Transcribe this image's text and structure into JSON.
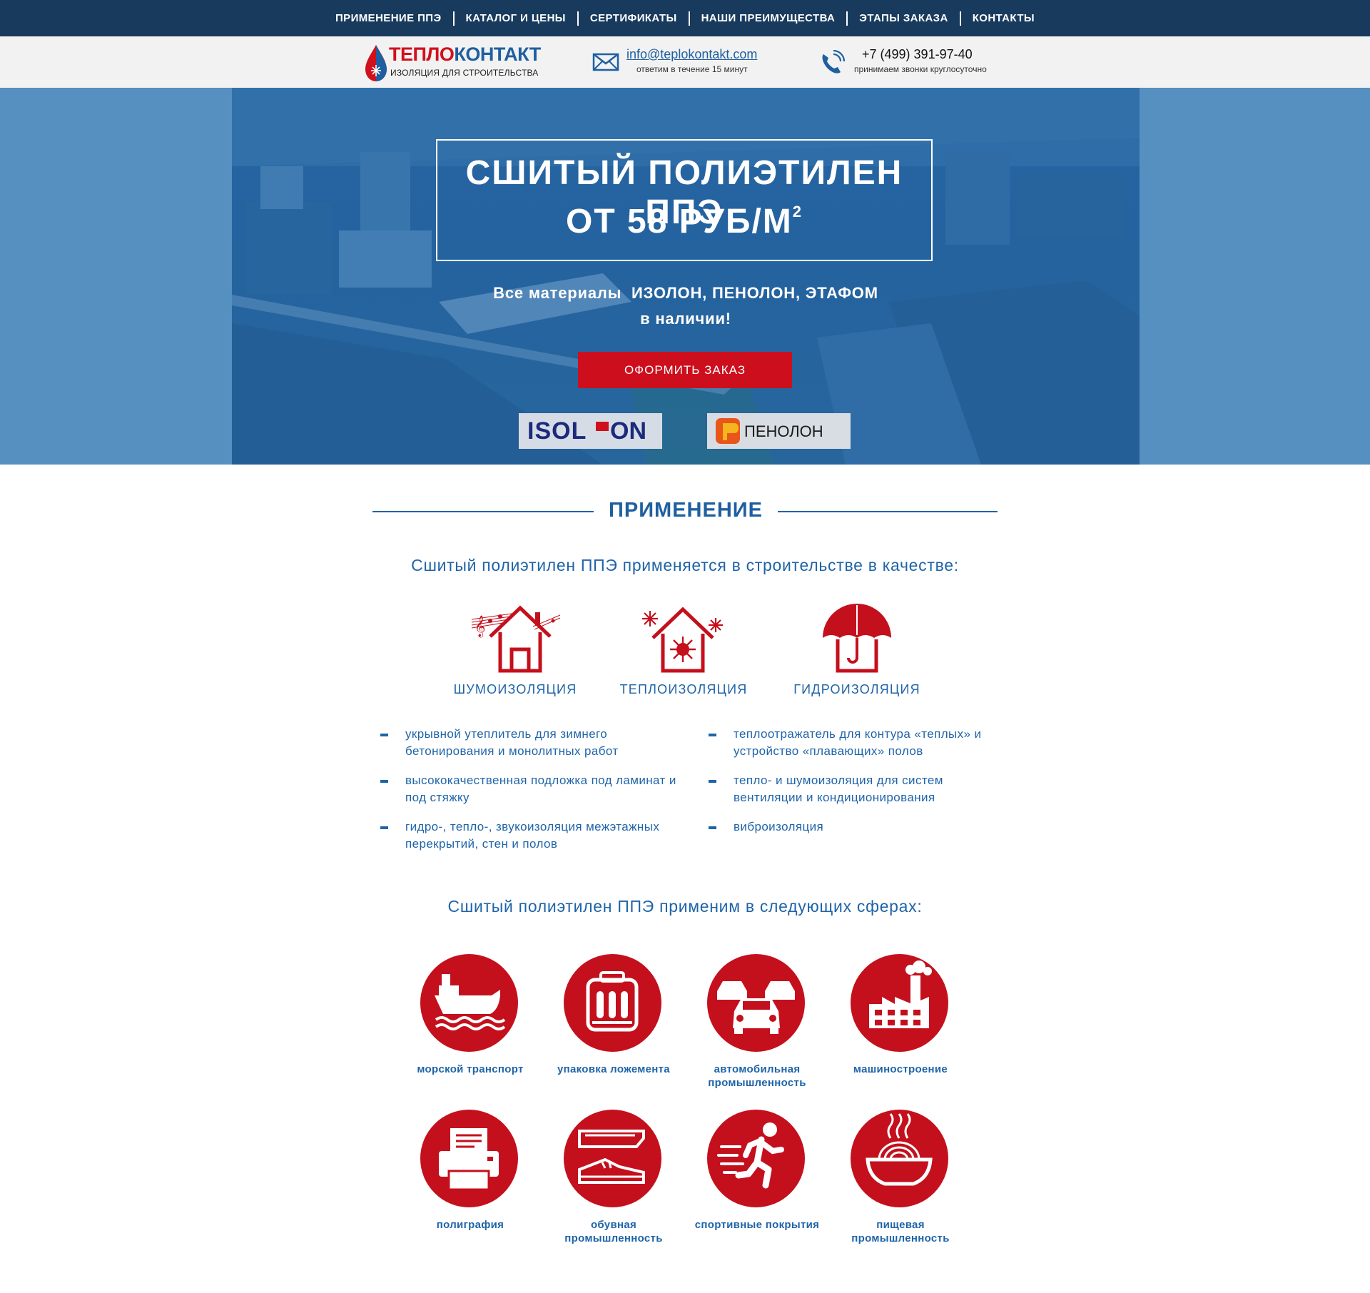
{
  "nav": {
    "items": [
      {
        "label": "ПРИМЕНЕНИЕ ППЭ"
      },
      {
        "label": "КАТАЛОГ И ЦЕНЫ"
      },
      {
        "label": "СЕРТИФИКАТЫ"
      },
      {
        "label": "НАШИ ПРЕИМУЩЕСТВА"
      },
      {
        "label": "ЭТАПЫ ЗАКАЗА"
      },
      {
        "label": "КОНТАКТЫ"
      }
    ]
  },
  "header": {
    "logo": {
      "title_part1": "ТЕПЛО",
      "title_part2": "КОНТАКТ",
      "subtitle": "ИЗОЛЯЦИЯ ДЛЯ СТРОИТЕЛЬСТВА"
    },
    "email": {
      "address": "info@teplokontakt.com",
      "note": "ответим в течение 15 минут",
      "icon": "envelope-icon"
    },
    "phone": {
      "number": "+7 (499) 391-97-40",
      "note": "принимаем звонки круглосуточно",
      "icon": "phone-icon"
    }
  },
  "hero": {
    "title_line1": "СШИТЫЙ ПОЛИЭТИЛЕН ППЭ",
    "title_line2": "ОТ 58 РУБ/М",
    "title_sup": "2",
    "subtitle_line1": "Все материалы  ИЗОЛОН, ПЕНОЛОН, ЭТАФОМ",
    "subtitle_line2": "в наличии!",
    "order_button": "ОФОРМИТЬ ЗАКАЗ",
    "brands": [
      {
        "name": "ISOLON",
        "logo_text_a": "ISOL",
        "logo_text_b": "ON"
      },
      {
        "name": "ПЕНОЛОН",
        "logo_text": "ПЕНОЛОН"
      }
    ]
  },
  "application": {
    "title": "ПРИМЕНЕНИЕ",
    "intro": "Сшитый полиэтилен ППЭ применяется в строительстве в качестве:",
    "types": [
      {
        "label": "ШУМОИЗОЛЯЦИЯ",
        "icon": "house-music-icon"
      },
      {
        "label": "ТЕПЛОИЗОЛЯЦИЯ",
        "icon": "house-sun-snow-icon"
      },
      {
        "label": "ГИДРОИЗОЛЯЦИЯ",
        "icon": "house-umbrella-icon"
      }
    ],
    "uses_left": [
      "укрывной утеплитель для зимнего бетонирования и монолитных работ",
      "высококачественная подложка под ламинат и под стяжку",
      "гидро-, тепло-, звукоизоляция межэтажных перекрытий, стен и полов"
    ],
    "uses_right": [
      "теплоотражатель для контура «теплых» и устройство «плавающих» полов",
      "тепло- и шумоизоляция для систем вентиляции и кондиционирования",
      "виброизоляция"
    ]
  },
  "spheres": {
    "intro": "Сшитый полиэтилен ППЭ применим в следующих сферах:",
    "items": [
      {
        "label": "морской транспорт",
        "icon": "ship-icon"
      },
      {
        "label": "упаковка ложемента",
        "icon": "case-icon"
      },
      {
        "label": "автомобильная промышленность",
        "icon": "cars-icon"
      },
      {
        "label": "машиностроение",
        "icon": "factory-icon"
      },
      {
        "label": "полиграфия",
        "icon": "printer-icon"
      },
      {
        "label": "обувная промышленность",
        "icon": "shoes-icon"
      },
      {
        "label": "спортивные покрытия",
        "icon": "runner-icon"
      },
      {
        "label": "пищевая промышленность",
        "icon": "food-bowl-icon"
      }
    ]
  },
  "colors": {
    "nav_bg": "#173a5d",
    "accent_red": "#cd0f1d",
    "brand_blue": "#1f5fa0",
    "hero_blue": "#5590c0"
  }
}
